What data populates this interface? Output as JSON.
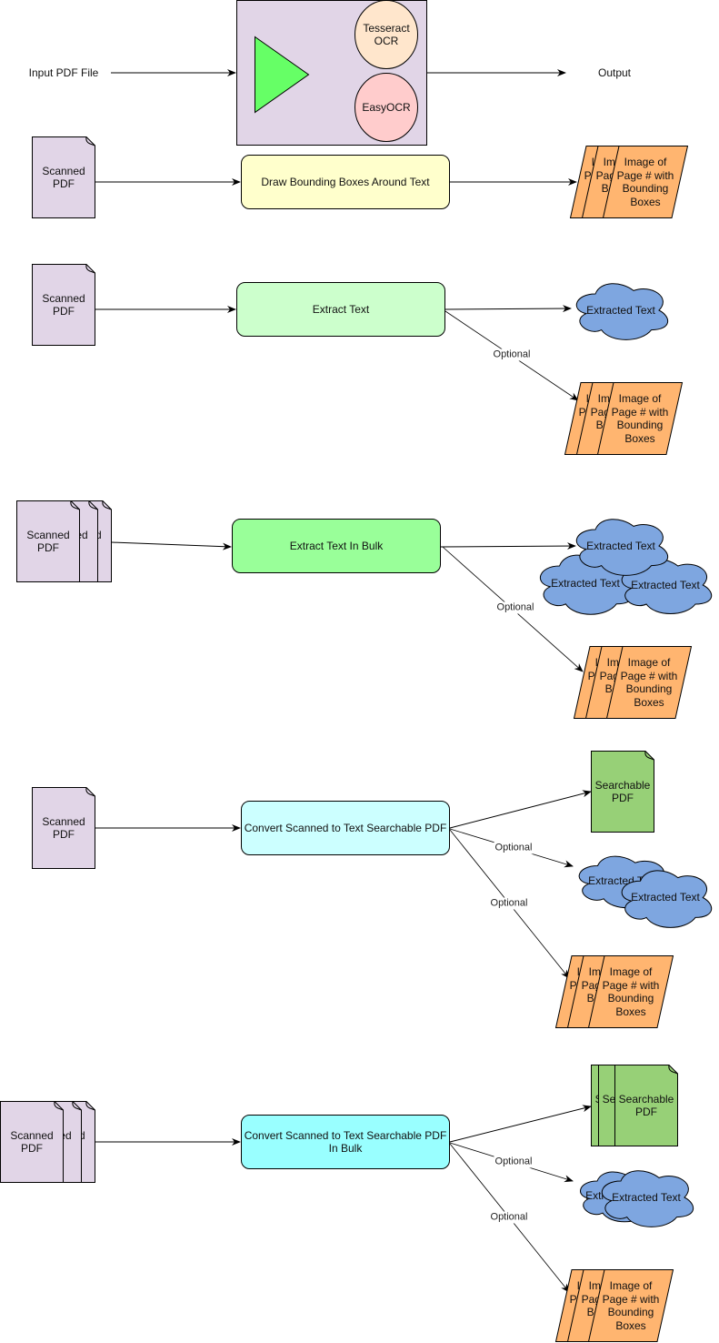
{
  "overview": {
    "input_label": "Input PDF File",
    "output_label": "Output",
    "engine_1": "Tesseract OCR",
    "engine_2": "EasyOCR"
  },
  "labels": {
    "scanned_pdf": "Scanned PDF",
    "image_output": "Image of Page # with Bounding Boxes",
    "extracted_text": "Extracted Text",
    "searchable_pdf": "Searchable PDF",
    "optional": "Optional"
  },
  "processes": [
    "Draw Bounding Boxes Around Text",
    "Extract Text",
    "Extract Text In Bulk",
    "Convert Scanned to Text Searchable PDF",
    "Convert Scanned to Text Searchable PDF In Bulk"
  ],
  "colors": {
    "container": "#e1d5e7",
    "router": "#66ff66",
    "tesseract": "#ffe6cc",
    "easyocr": "#ffcccc",
    "scanned_doc": "#e1d5e7",
    "process_1": "#ffffcc",
    "process_2": "#ccffcc",
    "process_3": "#99ff99",
    "process_4": "#ccffff",
    "process_5": "#99ffff",
    "searchable_pdf": "#97d077",
    "cloud": "#7ea6e0",
    "image_output": "#ffb570",
    "stroke": "#000000"
  }
}
